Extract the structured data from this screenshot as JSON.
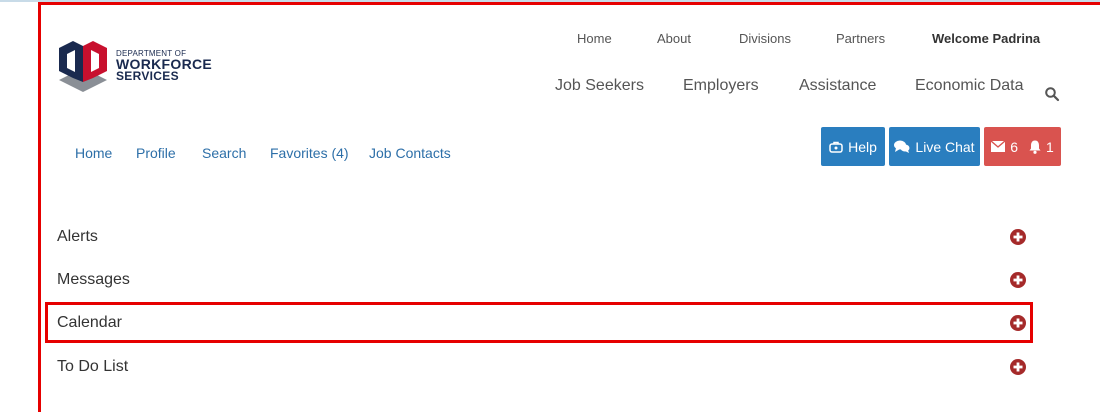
{
  "logo": {
    "dept": "DEPARTMENT OF",
    "line1": "WORKFORCE",
    "line2": "SERVICES"
  },
  "util_nav": {
    "home": "Home",
    "about": "About",
    "divisions": "Divisions",
    "partners": "Partners",
    "welcome": "Welcome Padrina"
  },
  "main_nav": {
    "job_seekers": "Job Seekers",
    "employers": "Employers",
    "assistance": "Assistance",
    "economic_data": "Economic Data"
  },
  "sub_nav": {
    "home": "Home",
    "profile": "Profile",
    "search": "Search",
    "favorites": "Favorites (4)",
    "job_contacts": "Job Contacts"
  },
  "buttons": {
    "help": "Help",
    "live_chat": "Live Chat",
    "messages_count": "6",
    "alerts_count": "1"
  },
  "sections": [
    {
      "label": "Alerts",
      "highlighted": false
    },
    {
      "label": "Messages",
      "highlighted": false
    },
    {
      "label": "Calendar",
      "highlighted": true
    },
    {
      "label": "To Do List",
      "highlighted": false
    }
  ],
  "icons": {
    "search": "search-icon",
    "help": "help-icon",
    "chat": "chat-icon",
    "envelope": "envelope-icon",
    "bell": "bell-icon",
    "expand": "plus-circle-icon"
  },
  "colors": {
    "link": "#2d6fa8",
    "primary_button": "#2a7ebf",
    "danger_button": "#d9534f",
    "expand_icon": "#a52a2a",
    "highlight": "#e60000",
    "logo_navy": "#1a2a4f"
  }
}
